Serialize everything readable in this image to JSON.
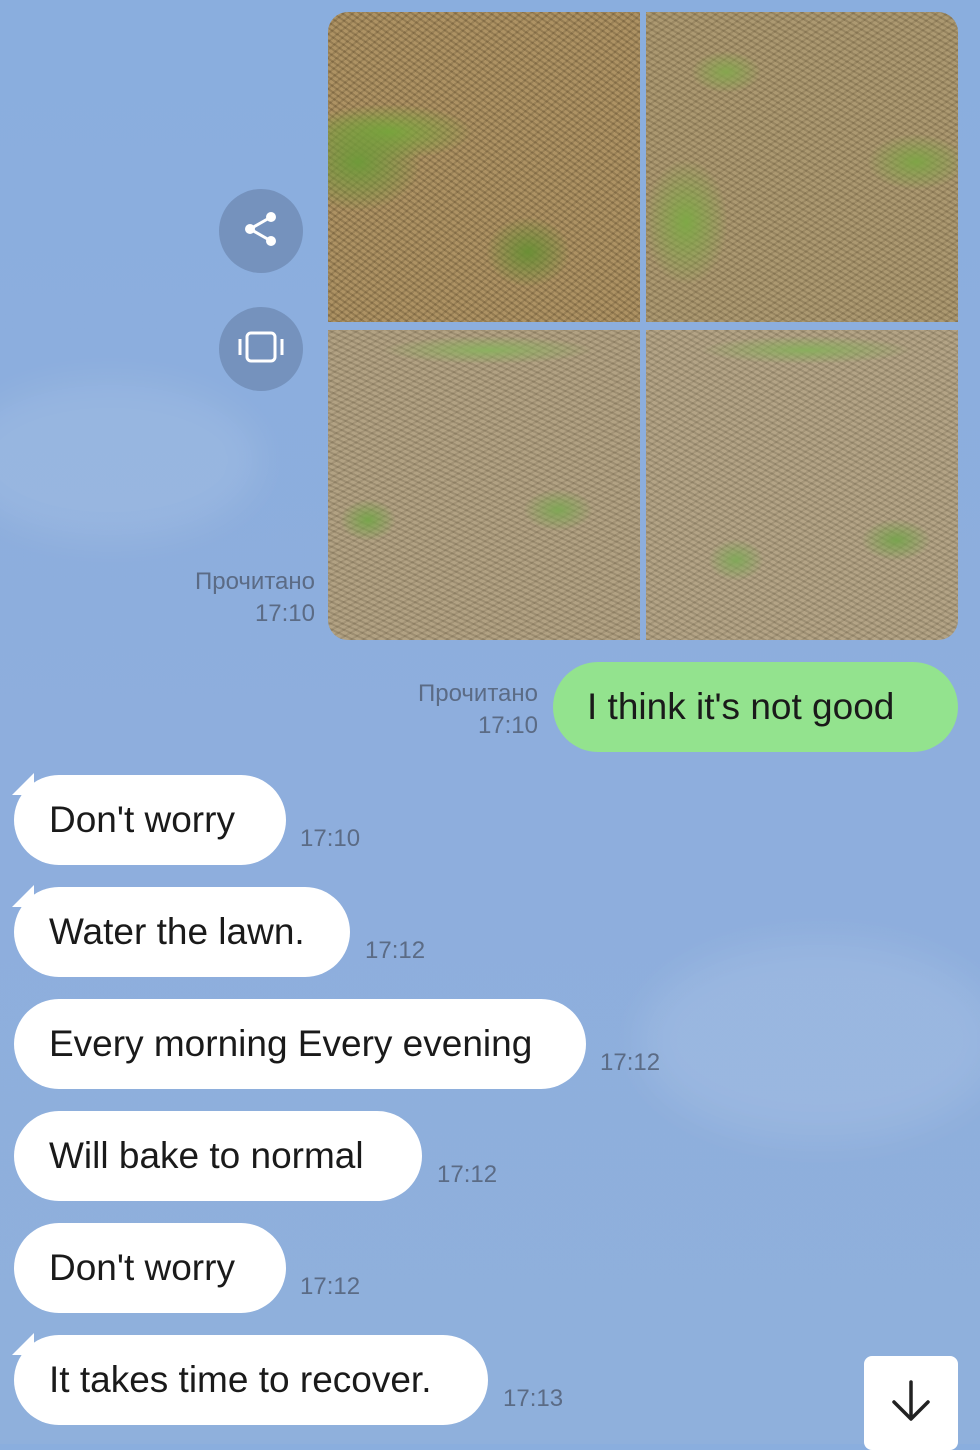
{
  "photo_message": {
    "status": "Прочитано",
    "time": "17:10",
    "action_icons": [
      "share-icon",
      "gallery-icon"
    ]
  },
  "outgoing_message": {
    "text": "I think it's not good",
    "status": "Прочитано",
    "time": "17:10"
  },
  "incoming_messages": [
    {
      "text": "Don't worry",
      "time": "17:10"
    },
    {
      "text": "Water the lawn.",
      "time": "17:12"
    },
    {
      "text": "Every morning Every evening",
      "time": "17:12"
    },
    {
      "text": "Will bake to normal",
      "time": "17:12"
    },
    {
      "text": "Don't worry",
      "time": "17:12"
    },
    {
      "text": "It takes time to recover.",
      "time": "17:13"
    }
  ],
  "scroll_down_icon": "arrow-down-icon",
  "colors": {
    "background": "#8aaede",
    "outgoing_bubble": "#93e38e",
    "incoming_bubble": "#ffffff",
    "meta_text": "#5b6b85",
    "circle_button": "#7592bd"
  }
}
